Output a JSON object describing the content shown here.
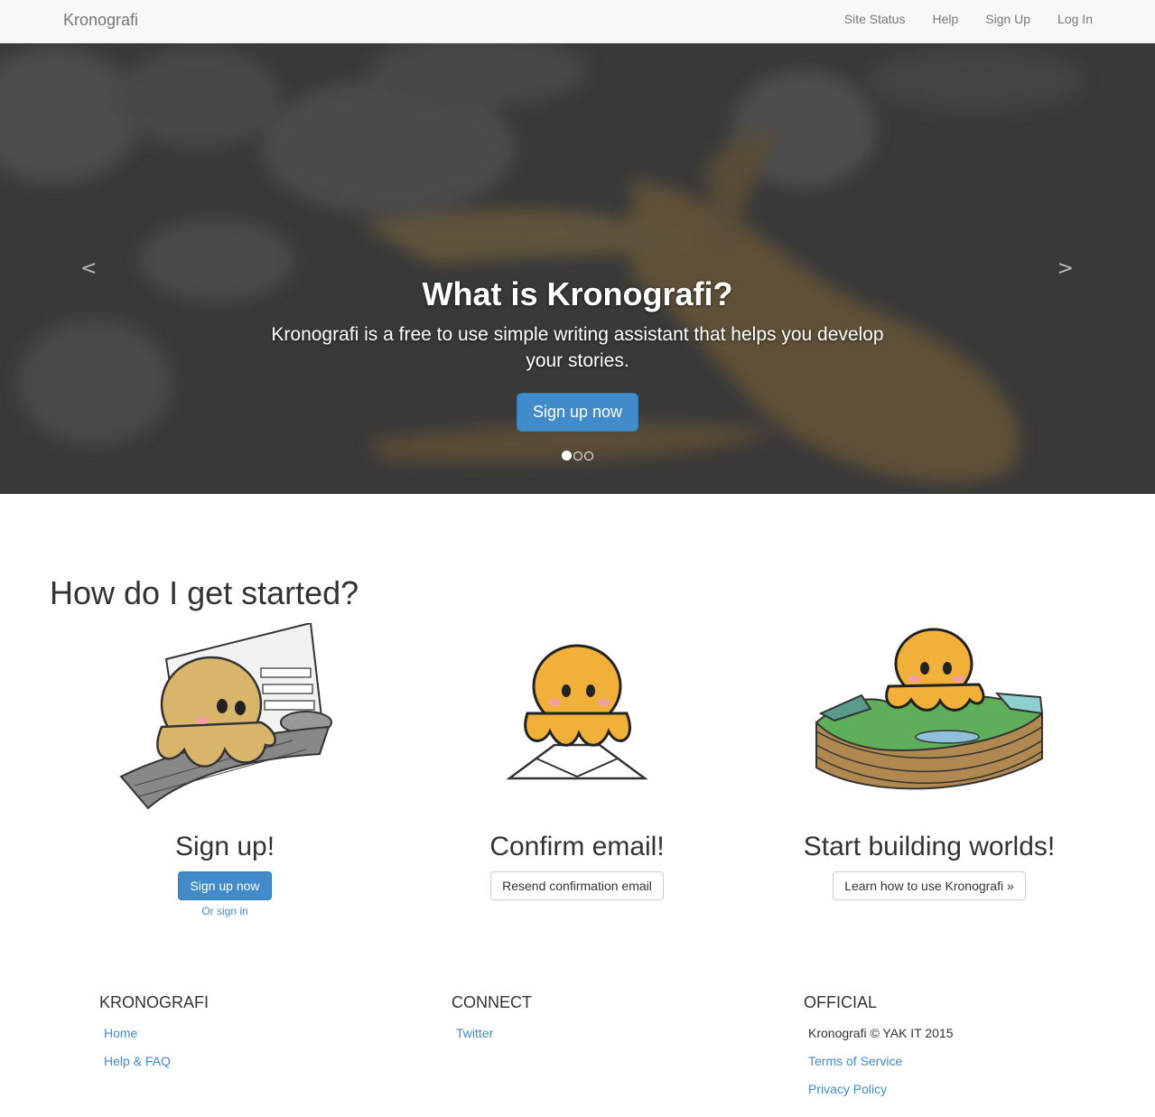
{
  "navbar": {
    "brand": "Kronografi",
    "links": [
      "Site Status",
      "Help",
      "Sign Up",
      "Log In"
    ]
  },
  "hero": {
    "title": "What is Kronografi?",
    "text": "Kronografi is a free to use simple writing assistant that helps you develop your stories.",
    "button": "Sign up now",
    "prev": "<",
    "next": ">",
    "slide_count": 3,
    "active_slide": 1
  },
  "started": {
    "title": "How do I get started?",
    "steps": [
      {
        "heading": "Sign up!",
        "button": "Sign up now",
        "link": "Or sign in"
      },
      {
        "heading": "Confirm email!",
        "button": "Resend confirmation email"
      },
      {
        "heading": "Start building worlds!",
        "button": "Learn how to use Kronografi »"
      }
    ]
  },
  "footer": {
    "kronografi": {
      "title": "KRONOGRAFI",
      "links": [
        "Home",
        "Help & FAQ"
      ]
    },
    "connect": {
      "title": "CONNECT",
      "links": [
        "Twitter"
      ]
    },
    "official": {
      "title": "OFFICIAL",
      "copyright": "Kronografi © YAK IT 2015",
      "links": [
        "Terms of Service",
        "Privacy Policy"
      ]
    }
  },
  "colors": {
    "primary": "#428bca",
    "octopus": "#f0b03a",
    "hero_dark": "#3f3f3f",
    "hero_accent": "#8a6d3b"
  }
}
